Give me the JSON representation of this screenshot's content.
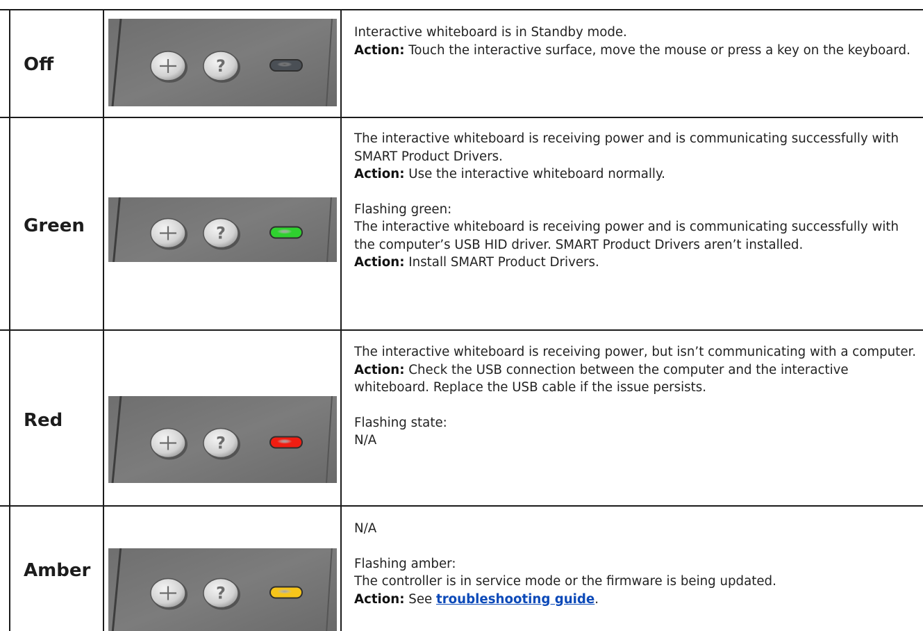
{
  "rows": [
    {
      "label": "Off",
      "led": "off",
      "led_color": "#4a4f55",
      "lines": [
        {
          "text": "Interactive whiteboard is in Standby mode."
        },
        {
          "bold": "Action:",
          "text": " Touch the interactive surface, move the mouse or press a key on the keyboard."
        }
      ]
    },
    {
      "label": "Green",
      "led": "green",
      "led_color": "#2fd12f",
      "lines": [
        {
          "text": "The interactive whiteboard is receiving power and is communicating successfully with SMART Product Drivers."
        },
        {
          "bold": "Action:",
          "text": " Use the interactive whiteboard normally."
        }
      ],
      "flash_title": "Flashing green:",
      "flash_lines": [
        {
          "text": "The interactive whiteboard is receiving power and is communicating successfully with the computer’s USB HID driver. SMART Product Drivers aren’t installed."
        },
        {
          "bold": "Action:",
          "text": " Install SMART Product Drivers."
        }
      ]
    },
    {
      "label": "Red",
      "led": "red",
      "led_color": "#f01d12",
      "lines": [
        {
          "text": "The interactive whiteboard is receiving power, but isn’t communicating with a computer."
        },
        {
          "bold": "Action:",
          "text": " Check the USB connection between the computer and the interactive whiteboard. Replace the USB cable if the issue persists."
        }
      ],
      "flash_title": "Flashing state:",
      "flash_lines": [
        {
          "text": "N/A"
        }
      ]
    },
    {
      "label": "Amber",
      "led": "amber",
      "led_color": "#f7c51a",
      "lines": [
        {
          "text": "N/A"
        }
      ],
      "flash_title": "Flashing amber:",
      "flash_lines": [
        {
          "text": "The controller is in service mode or the firmware is being updated."
        },
        {
          "bold": "Action:",
          "text": " See ",
          "link": "troubleshooting guide",
          "after": "."
        }
      ]
    }
  ]
}
